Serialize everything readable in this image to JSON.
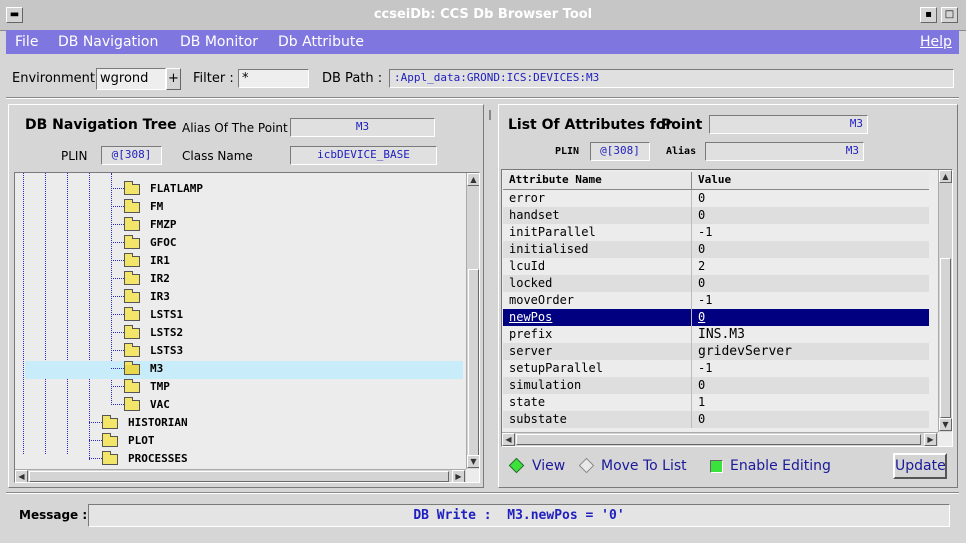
{
  "window": {
    "title": "ccseiDb: CCS Db Browser Tool"
  },
  "menu": {
    "file": "File",
    "db_navigation": "DB Navigation",
    "db_monitor": "DB Monitor",
    "db_attribute": "Db Attribute",
    "help": "Help"
  },
  "toolbar": {
    "environment_label": "Environment:",
    "environment_value": "wgrond",
    "env_plus": "+",
    "filter_label": "Filter :",
    "filter_value": "*",
    "dbpath_label": "DB Path :",
    "dbpath_value": ":Appl_data:GROND:ICS:DEVICES:M3"
  },
  "nav": {
    "heading": "DB Navigation Tree",
    "alias_label": "Alias Of The Point",
    "alias_value": "M3",
    "plin_label": "PLIN",
    "plin_value": "@[308]",
    "class_label": "Class Name",
    "class_value": "icbDEVICE_BASE",
    "tree_items": [
      "FLATLAMP",
      "FM",
      "FMZP",
      "GFOC",
      "IR1",
      "IR2",
      "IR3",
      "LSTS1",
      "LSTS2",
      "LSTS3",
      "M3",
      "TMP",
      "VAC",
      "HISTORIAN",
      "PLOT",
      "PROCESSES"
    ],
    "selected": "M3"
  },
  "attrs": {
    "heading": "List Of Attributes for",
    "point_label": "Point",
    "point_value": "M3",
    "plin_label": "PLIN",
    "plin_value": "@[308]",
    "alias_label": "Alias",
    "alias_value": "M3",
    "col_name": "Attribute Name",
    "col_value": "Value",
    "rows": [
      {
        "name": "error",
        "value": "0"
      },
      {
        "name": "handset",
        "value": "0"
      },
      {
        "name": "initParallel",
        "value": "-1"
      },
      {
        "name": "initialised",
        "value": "0"
      },
      {
        "name": "lcuId",
        "value": "2"
      },
      {
        "name": "locked",
        "value": "0"
      },
      {
        "name": "moveOrder",
        "value": "-1"
      },
      {
        "name": "newPos",
        "value": "0"
      },
      {
        "name": "prefix",
        "value": "INS.M3"
      },
      {
        "name": "server",
        "value": "gridevServer"
      },
      {
        "name": "setupParallel",
        "value": "-1"
      },
      {
        "name": "simulation",
        "value": "0"
      },
      {
        "name": "state",
        "value": "1"
      },
      {
        "name": "substate",
        "value": "0"
      }
    ],
    "selected_row": "newPos",
    "view_label": "View",
    "move_label": "Move To List",
    "edit_label": "Enable Editing",
    "update_label": "Update"
  },
  "status": {
    "label": "Message :",
    "message": "DB Write :  M3.newPos = '0'"
  },
  "colors": {
    "menu_bg": "#7f76df",
    "selection": "#000080",
    "tree_selection": "#c8ecfa",
    "link": "#2020c0"
  }
}
